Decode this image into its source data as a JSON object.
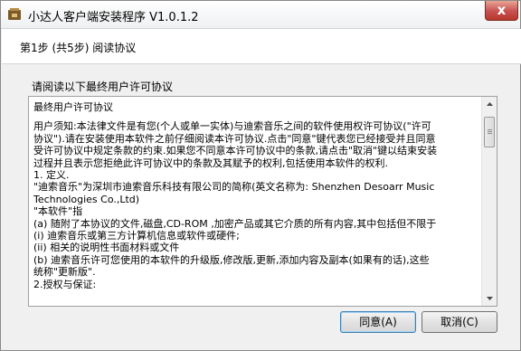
{
  "window": {
    "title": "小达人客户端安装程序 V1.0.1.2",
    "close_glyph": "x"
  },
  "header": {
    "step": "第1步 (共5步) 阅读协议"
  },
  "main": {
    "instruction": "请阅读以下最终用户许可协议",
    "license_lines": [
      "最终用户许可协议",
      "",
      "用户须知:本法律文件是有您(个人或单一实体)与迪索音乐之间的软件使用权许可协议(\"许可",
      "协议\").请在安装使用本软件之前仔细阅读本许可协议.点击\"同意\"键代表您已经接受并且同意",
      "受许可协议中规定条款的约束.如果您不同意本许可协议中的条款,请点击\"取消\"键以结束安装",
      "过程并且表示您拒绝此许可协议中的条款及其赋予的权利,包括使用本软件的权利.",
      "1. 定义.",
      "\"迪索音乐\"为深圳市迪索音乐科技有限公司的简称(英文名称为: Shenzhen Desoarr Music",
      "Technologies Co.,Ltd)",
      "\"本软件\"指",
      "(a) 随附了本协议的文件,磁盘,CD-ROM ,加密产品或其它介质的所有内容,其中包括但不限于",
      "(i) 迪索音乐或第三方计算机信息或软件或硬件;",
      "(ii) 相关的说明性书面材料或文件",
      "(b) 迪索音乐许可您使用的本软件的升级版,修改版,更新,添加内容及副本(如果有的话),这些",
      "统称\"更新版\".",
      "2.授权与保证:"
    ]
  },
  "buttons": {
    "agree": "同意(A)",
    "cancel": "取消(C)"
  }
}
